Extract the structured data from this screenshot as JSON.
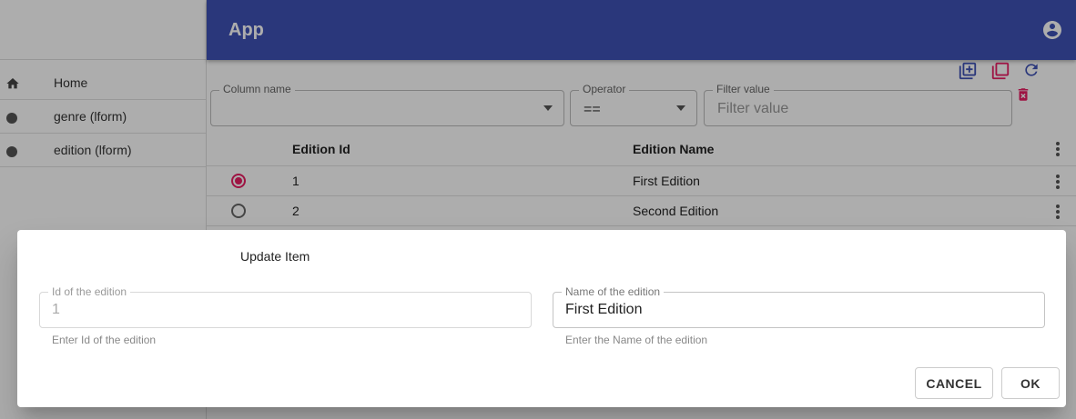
{
  "app": {
    "title": "App"
  },
  "sidebar": {
    "items": [
      {
        "label": "Home",
        "icon": "home-icon"
      },
      {
        "label": "genre (lform)",
        "icon": "dot-icon"
      },
      {
        "label": "edition (lform)",
        "icon": "dot-icon"
      }
    ]
  },
  "filter": {
    "column_name_label": "Column name",
    "column_name_value": "",
    "operator_label": "Operator",
    "operator_value": "==",
    "filter_value_label": "Filter value",
    "filter_value_placeholder": "Filter value"
  },
  "grid": {
    "columns": [
      "Edition Id",
      "Edition Name"
    ],
    "rows": [
      {
        "id": "1",
        "name": "First Edition",
        "selected": true
      },
      {
        "id": "2",
        "name": "Second Edition",
        "selected": false
      }
    ]
  },
  "dialog": {
    "title": "Update Item",
    "id_field": {
      "label": "Id of the edition",
      "value": "1",
      "helper": "Enter Id of the edition"
    },
    "name_field": {
      "label": "Name of the edition",
      "value": "First Edition",
      "helper": "Enter the Name of the edition"
    },
    "cancel_label": "CANCEL",
    "ok_label": "OK"
  },
  "colors": {
    "appbar": "#3f51b5",
    "accent": "#e91e63"
  }
}
